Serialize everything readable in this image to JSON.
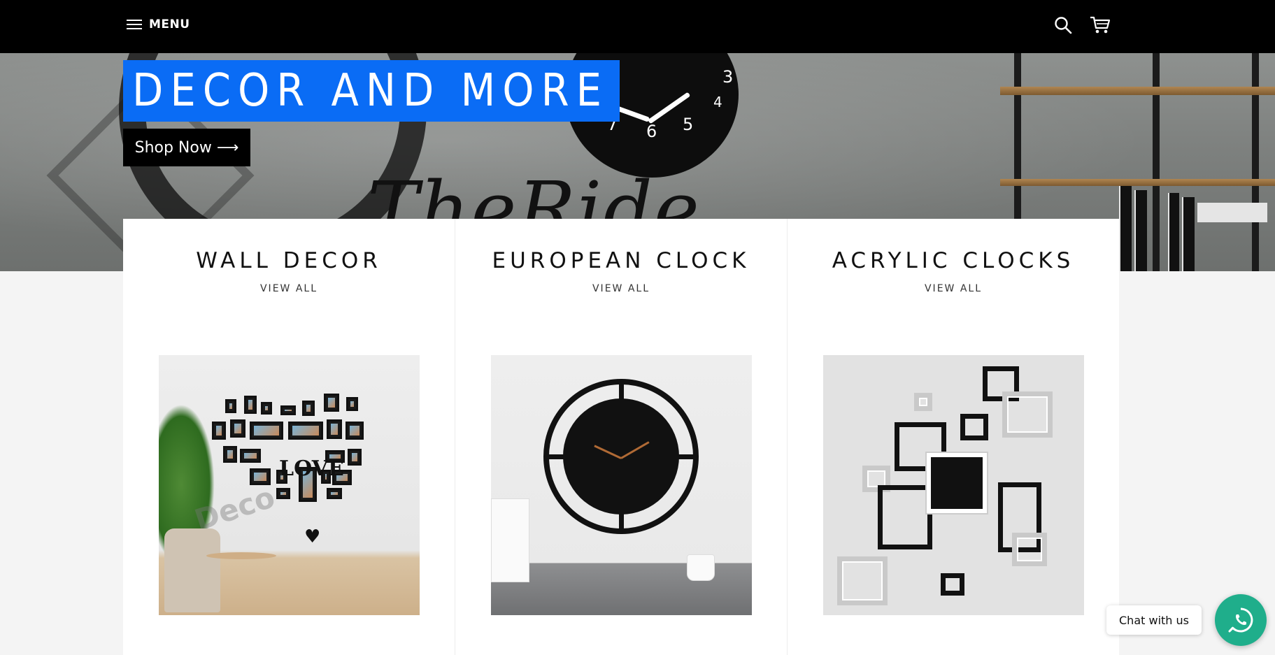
{
  "header": {
    "menu_label": "MENU",
    "icons": [
      "hamburger-icon",
      "search-icon",
      "cart-icon"
    ]
  },
  "hero": {
    "title": "DECOR AND MORE",
    "cta_label": "Shop Now ⟶",
    "title_bg_color": "#0a6cf5"
  },
  "collections": [
    {
      "title": "WALL DECOR",
      "link_label": "VIEW ALL"
    },
    {
      "title": "EUROPEAN CLOCK",
      "link_label": "VIEW ALL"
    },
    {
      "title": "ACRYLIC CLOCKS",
      "link_label": "VIEW ALL"
    }
  ],
  "chat": {
    "label": "Chat with us",
    "button_color": "#1fae8b"
  }
}
